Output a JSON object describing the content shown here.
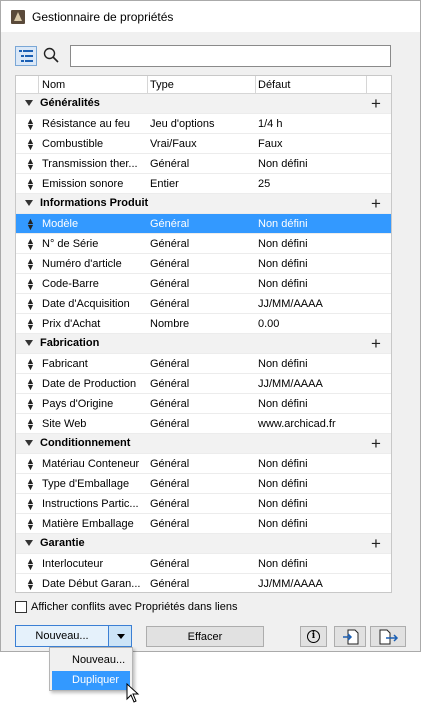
{
  "window": {
    "title": "Gestionnaire de propriétés"
  },
  "search": {
    "value": "",
    "placeholder": ""
  },
  "columns": {
    "name": "Nom",
    "type": "Type",
    "default": "Défaut"
  },
  "groups": [
    {
      "name": "Généralités",
      "rows": [
        {
          "name": "Résistance au feu",
          "type": "Jeu d'options",
          "default": "1/4 h"
        },
        {
          "name": "Combustible",
          "type": "Vrai/Faux",
          "default": "Faux"
        },
        {
          "name": "Transmission ther...",
          "type": "Général",
          "default": "Non défini"
        },
        {
          "name": "Emission sonore",
          "type": "Entier",
          "default": "25"
        }
      ]
    },
    {
      "name": "Informations Produit",
      "rows": [
        {
          "name": "Modèle",
          "type": "Général",
          "default": "Non défini",
          "selected": true
        },
        {
          "name": "N° de Série",
          "type": "Général",
          "default": "Non défini"
        },
        {
          "name": "Numéro d'article",
          "type": "Général",
          "default": "Non défini"
        },
        {
          "name": "Code-Barre",
          "type": "Général",
          "default": "Non défini"
        },
        {
          "name": "Date d'Acquisition",
          "type": "Général",
          "default": "JJ/MM/AAAA"
        },
        {
          "name": "Prix d'Achat",
          "type": "Nombre",
          "default": "0.00"
        }
      ]
    },
    {
      "name": "Fabrication",
      "rows": [
        {
          "name": "Fabricant",
          "type": "Général",
          "default": "Non défini"
        },
        {
          "name": "Date de Production",
          "type": "Général",
          "default": "JJ/MM/AAAA"
        },
        {
          "name": "Pays d'Origine",
          "type": "Général",
          "default": "Non défini"
        },
        {
          "name": "Site Web",
          "type": "Général",
          "default": "www.archicad.fr"
        }
      ]
    },
    {
      "name": "Conditionnement",
      "rows": [
        {
          "name": "Matériau Conteneur",
          "type": "Général",
          "default": "Non défini"
        },
        {
          "name": "Type d'Emballage",
          "type": "Général",
          "default": "Non défini"
        },
        {
          "name": "Instructions Partic...",
          "type": "Général",
          "default": "Non défini"
        },
        {
          "name": "Matière Emballage",
          "type": "Général",
          "default": "Non défini"
        }
      ]
    },
    {
      "name": "Garantie",
      "rows": [
        {
          "name": "Interlocuteur",
          "type": "Général",
          "default": "Non défini"
        },
        {
          "name": "Date Début Garan...",
          "type": "Général",
          "default": "JJ/MM/AAAA"
        }
      ]
    }
  ],
  "footer": {
    "checkbox_label": "Afficher conflits avec Propriétés dans liens",
    "checkbox_checked": false,
    "new_label": "Nouveau...",
    "clear_label": "Effacer",
    "info_glyph": "i"
  },
  "dropdown_menu": {
    "items": [
      {
        "label": "Nouveau...",
        "highlighted": false
      },
      {
        "label": "Dupliquer",
        "highlighted": true
      }
    ]
  },
  "colors": {
    "selection": "#3399ff",
    "group_bg": "#f2f2f2",
    "accent_border": "#3b7fd4"
  },
  "icons": [
    "list-view-icon",
    "search-icon",
    "drag-handle-icon",
    "collapse-caret-icon",
    "add-property-icon",
    "info-icon",
    "import-icon",
    "export-icon",
    "dropdown-arrow-icon",
    "mouse-cursor-icon"
  ]
}
